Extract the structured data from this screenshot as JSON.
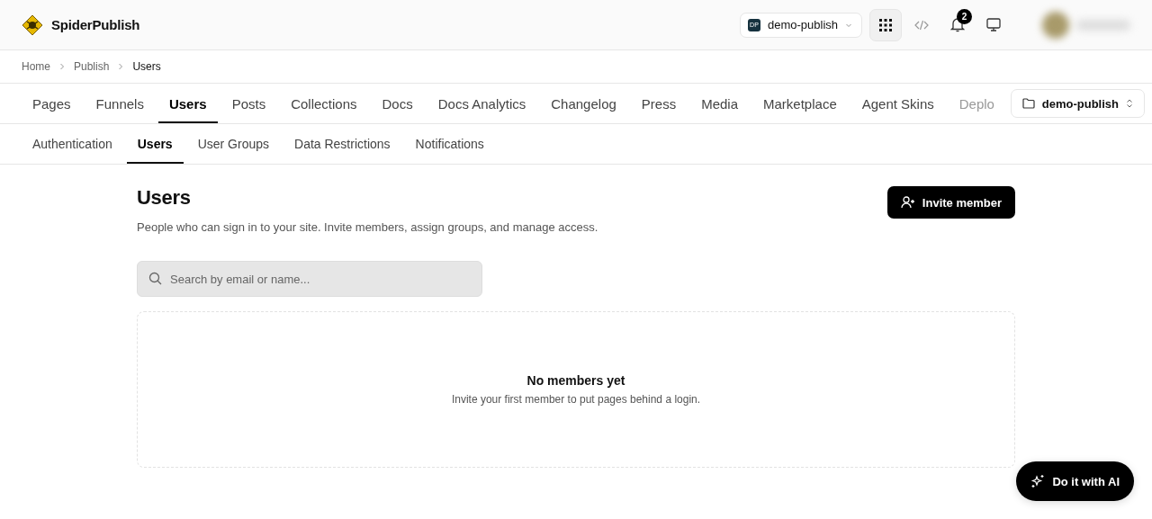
{
  "brand": {
    "name": "SpiderPublish"
  },
  "header": {
    "workspace": {
      "badge": "DP",
      "name": "demo-publish"
    },
    "notifications": {
      "count": "2"
    }
  },
  "breadcrumbs": [
    {
      "label": "Home"
    },
    {
      "label": "Publish"
    },
    {
      "label": "Users"
    }
  ],
  "tabs": [
    {
      "label": "Pages",
      "selected": false
    },
    {
      "label": "Funnels",
      "selected": false
    },
    {
      "label": "Users",
      "selected": true
    },
    {
      "label": "Posts",
      "selected": false
    },
    {
      "label": "Collections",
      "selected": false
    },
    {
      "label": "Docs",
      "selected": false
    },
    {
      "label": "Docs Analytics",
      "selected": false
    },
    {
      "label": "Changelog",
      "selected": false
    },
    {
      "label": "Press",
      "selected": false
    },
    {
      "label": "Media",
      "selected": false
    },
    {
      "label": "Marketplace",
      "selected": false
    },
    {
      "label": "Agent Skins",
      "selected": false
    },
    {
      "label": "Deplo",
      "selected": false
    }
  ],
  "site_selector": {
    "name": "demo-publish"
  },
  "subtabs": [
    {
      "label": "Authentication",
      "selected": false
    },
    {
      "label": "Users",
      "selected": true
    },
    {
      "label": "User Groups",
      "selected": false
    },
    {
      "label": "Data Restrictions",
      "selected": false
    },
    {
      "label": "Notifications",
      "selected": false
    }
  ],
  "page": {
    "title": "Users",
    "description": "People who can sign in to your site. Invite members, assign groups, and manage access.",
    "invite_button": "Invite member",
    "search": {
      "placeholder": "Search by email or name..."
    },
    "empty_state": {
      "title": "No members yet",
      "text": "Invite your first member to put pages behind a login."
    }
  },
  "ai_button": {
    "label": "Do it with AI"
  }
}
